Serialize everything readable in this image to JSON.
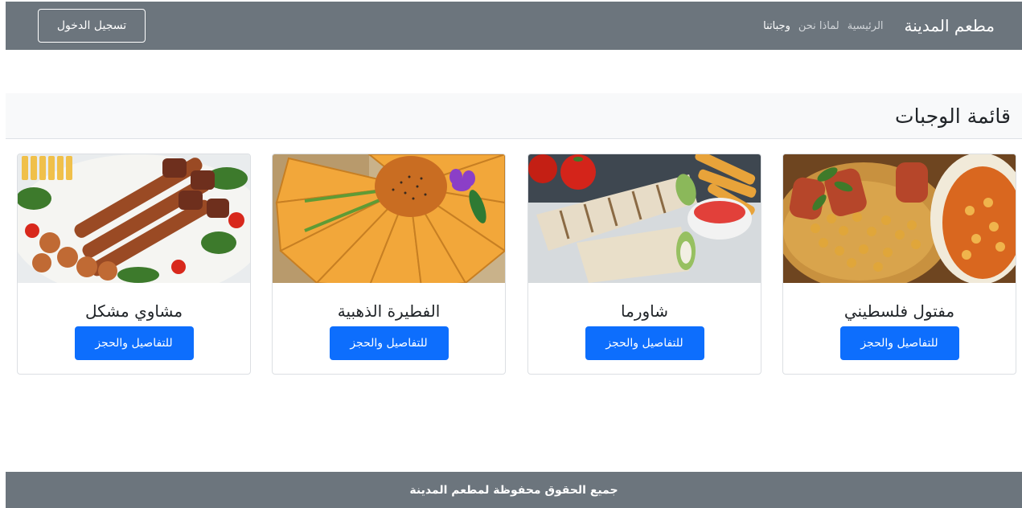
{
  "navbar": {
    "brand": "مطعم المدينة",
    "links": [
      {
        "label": "الرئيسية",
        "active": false
      },
      {
        "label": "لماذا نحن",
        "active": false
      },
      {
        "label": "وجباتنا",
        "active": true
      }
    ],
    "login_label": "تسجيل الدخول"
  },
  "section": {
    "title": "قائمة الوجبات"
  },
  "meals": [
    {
      "name": "مفتول فلسطيني",
      "button_label": "للتفاصيل والحجز"
    },
    {
      "name": "شاورما",
      "button_label": "للتفاصيل والحجز"
    },
    {
      "name": "الفطيرة الذهبية",
      "button_label": "للتفاصيل والحجز"
    },
    {
      "name": "مشاوي مشكل",
      "button_label": "للتفاصيل والحجز"
    }
  ],
  "footer": {
    "text": "جميع الحقوق محفوظة لمطعم المدينة"
  },
  "colors": {
    "navbar_bg": "#6c757d",
    "primary": "#0d6efd",
    "section_bg": "#f8f9fa"
  }
}
